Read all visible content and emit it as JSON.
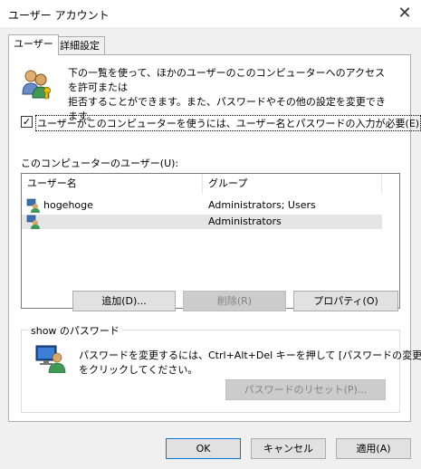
{
  "window": {
    "title": "ユーザー アカウント",
    "close_glyph": "✕"
  },
  "tabs": [
    {
      "label": "ユーザー",
      "active": true
    },
    {
      "label": "詳細設定",
      "active": false
    }
  ],
  "users_tab": {
    "description_line1": "下の一覧を使って、ほかのユーザーのこのコンピューターへのアクセスを許可または",
    "description_line2": "拒否することができます。また、パスワードやその他の設定を変更できます。",
    "require_login_checkbox": {
      "checked": true,
      "label": "ユーザーがこのコンピューターを使うには、ユーザー名とパスワードの入力が必要(E)"
    },
    "users_list_label": "このコンピューターのユーザー(U):",
    "columns": [
      "ユーザー名",
      "グループ"
    ],
    "rows": [
      {
        "name": "hogehoge",
        "group": "Administrators; Users",
        "selected": false
      },
      {
        "name": "",
        "group": "Administrators",
        "selected": true
      }
    ],
    "buttons": {
      "add": "追加(D)...",
      "remove": "削除(R)",
      "properties": "プロパティ(O)"
    },
    "password_group": {
      "title": "show のパスワード",
      "text_line1": "パスワードを変更するには、Ctrl+Alt+Del キーを押して [パスワードの変更]",
      "text_line2": "をクリックしてください。",
      "reset_button": "パスワードのリセット(P)..."
    }
  },
  "dialog_buttons": {
    "ok": "OK",
    "cancel": "キャンセル",
    "apply": "適用(A)"
  },
  "colors": {
    "selection": "#e5e5e5",
    "default_button_border": "#0078d7",
    "background": "#f0f0f0"
  }
}
